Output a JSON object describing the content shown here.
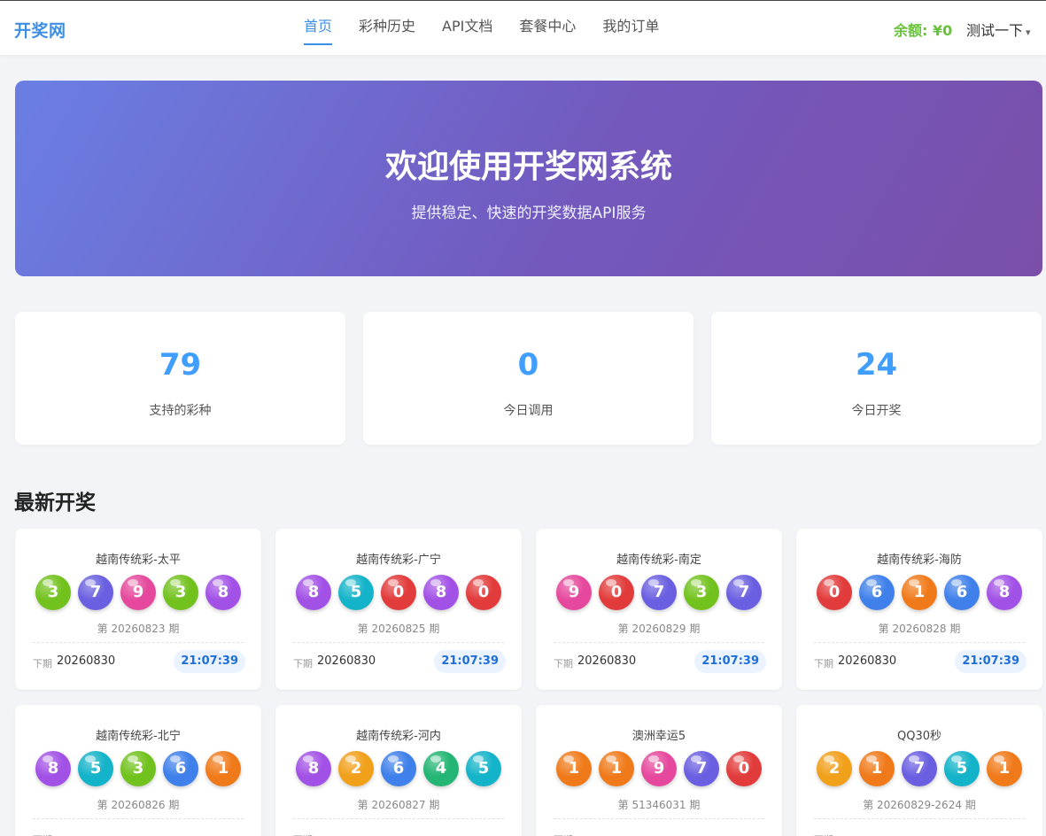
{
  "header": {
    "logo": "开奖网",
    "nav": [
      "首页",
      "彩种历史",
      "API文档",
      "套餐中心",
      "我的订单"
    ],
    "balance": "余额: ¥0",
    "user": "测试一下",
    "caret": "▾"
  },
  "hero": {
    "title": "欢迎使用开奖网系统",
    "subtitle": "提供稳定、快速的开奖数据API服务"
  },
  "stats": [
    {
      "value": "79",
      "label": "支持的彩种"
    },
    {
      "value": "0",
      "label": "今日调用"
    },
    {
      "value": "24",
      "label": "今日开奖"
    }
  ],
  "latest": {
    "title": "最新开奖",
    "next_label": "下期",
    "cards": [
      {
        "name": "越南传统彩-太平",
        "balls": [
          "3",
          "7",
          "9",
          "3",
          "8"
        ],
        "colors": [
          "#72c21e",
          "#6a5fe0",
          "#e5489c",
          "#72c21e",
          "#a251e6"
        ],
        "issue": "第 20260823 期",
        "next": "20260830",
        "countdown": "21:07:39"
      },
      {
        "name": "越南传统彩-广宁",
        "balls": [
          "8",
          "5",
          "0",
          "8",
          "0"
        ],
        "colors": [
          "#a251e6",
          "#13b3c9",
          "#e23b3b",
          "#a251e6",
          "#e23b3b"
        ],
        "issue": "第 20260825 期",
        "next": "20260830",
        "countdown": "21:07:39"
      },
      {
        "name": "越南传统彩-南定",
        "balls": [
          "9",
          "0",
          "7",
          "3",
          "7"
        ],
        "colors": [
          "#e5489c",
          "#e23b3b",
          "#6a5fe0",
          "#72c21e",
          "#6a5fe0"
        ],
        "issue": "第 20260829 期",
        "next": "20260830",
        "countdown": "21:07:39"
      },
      {
        "name": "越南传统彩-海防",
        "balls": [
          "0",
          "6",
          "1",
          "6",
          "8"
        ],
        "colors": [
          "#e23b3b",
          "#3f80ea",
          "#f07a1a",
          "#3f80ea",
          "#a251e6"
        ],
        "issue": "第 20260828 期",
        "next": "20260830",
        "countdown": "21:07:39"
      },
      {
        "name": "越南传统彩-北宁",
        "balls": [
          "8",
          "5",
          "3",
          "6",
          "1"
        ],
        "colors": [
          "#a251e6",
          "#13b3c9",
          "#72c21e",
          "#3f80ea",
          "#f07a1a"
        ],
        "issue": "第 20260826 期",
        "next": "",
        "countdown": ""
      },
      {
        "name": "越南传统彩-河内",
        "balls": [
          "8",
          "2",
          "6",
          "4",
          "5"
        ],
        "colors": [
          "#a251e6",
          "#f1a01a",
          "#3f80ea",
          "#22b573",
          "#13b3c9"
        ],
        "issue": "第 20260827 期",
        "next": "",
        "countdown": ""
      },
      {
        "name": "澳洲幸运5",
        "balls": [
          "1",
          "1",
          "9",
          "7",
          "0"
        ],
        "colors": [
          "#f07a1a",
          "#f07a1a",
          "#e5489c",
          "#6a5fe0",
          "#e23b3b"
        ],
        "issue": "第 51346031 期",
        "next": "",
        "countdown": ""
      },
      {
        "name": "QQ30秒",
        "balls": [
          "2",
          "1",
          "7",
          "5",
          "1"
        ],
        "colors": [
          "#f1a01a",
          "#f07a1a",
          "#6a5fe0",
          "#13b3c9",
          "#f07a1a"
        ],
        "issue": "第 20260829-2624 期",
        "next": "",
        "countdown": ""
      }
    ]
  }
}
